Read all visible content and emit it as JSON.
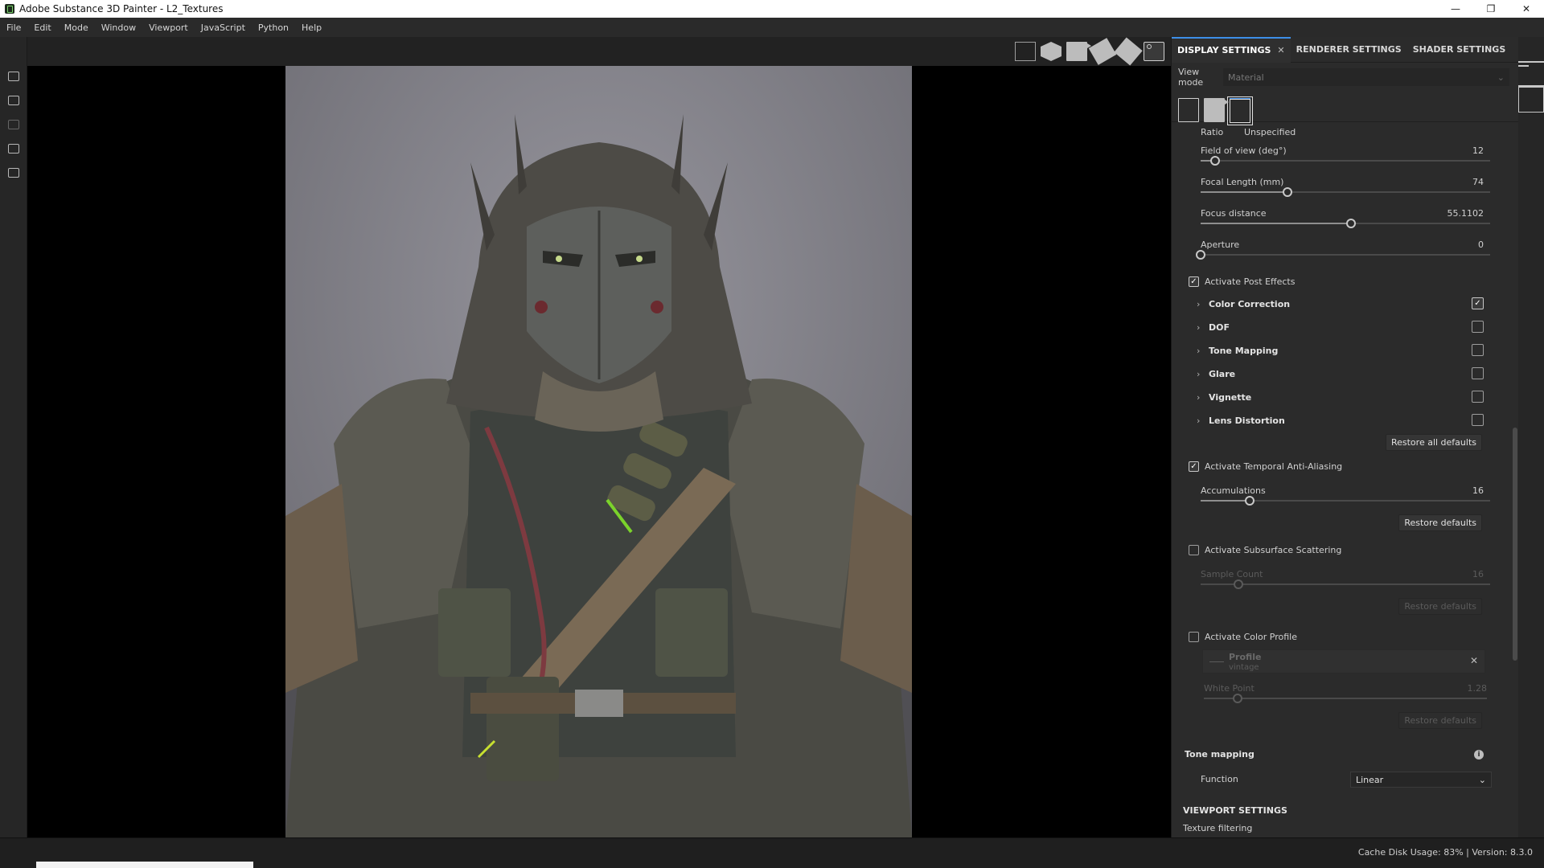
{
  "window": {
    "title": "Adobe Substance 3D Painter - L2_Textures",
    "controls": [
      "—",
      "❐",
      "✕"
    ]
  },
  "menu": [
    "File",
    "Edit",
    "Mode",
    "Window",
    "Viewport",
    "JavaScript",
    "Python",
    "Help"
  ],
  "panel": {
    "tabs": [
      {
        "label": "DISPLAY SETTINGS",
        "close": "✕"
      },
      {
        "label": "RENDERER SETTINGS"
      },
      {
        "label": "SHADER SETTINGS"
      }
    ],
    "view_mode": {
      "label": "View mode",
      "value": "Material"
    },
    "ratio": {
      "label": "Ratio",
      "value": "Unspecified"
    },
    "sliders": [
      {
        "label": "Field of view (deg°)",
        "value": "12",
        "fraction": 0.05
      },
      {
        "label": "Focal Length (mm)",
        "value": "74",
        "fraction": 0.3
      },
      {
        "label": "Focus distance",
        "value": "55.1102",
        "fraction": 0.52
      },
      {
        "label": "Aperture",
        "value": "0",
        "fraction": 0.0
      }
    ],
    "post_effects": {
      "label": "Activate Post Effects",
      "checked": true,
      "sections": [
        {
          "name": "Color Correction",
          "checked": true
        },
        {
          "name": "DOF",
          "checked": false
        },
        {
          "name": "Tone Mapping",
          "checked": false
        },
        {
          "name": "Glare",
          "checked": false
        },
        {
          "name": "Vignette",
          "checked": false
        },
        {
          "name": "Lens Distortion",
          "checked": false
        }
      ],
      "restore_all": "Restore all defaults"
    },
    "taa": {
      "label": "Activate Temporal Anti-Aliasing",
      "checked": true,
      "accumulations": {
        "label": "Accumulations",
        "value": "16",
        "fraction": 0.17
      },
      "restore": "Restore defaults"
    },
    "sss": {
      "label": "Activate Subsurface Scattering",
      "checked": false,
      "sample_count": {
        "label": "Sample Count",
        "value": "16",
        "fraction": 0.13
      },
      "restore": "Restore defaults"
    },
    "color_profile": {
      "label": "Activate Color Profile",
      "checked": false,
      "profile_title": "Profile",
      "profile_value": "vintage",
      "white_point": {
        "label": "White Point",
        "value": "1.28",
        "fraction": 0.12
      },
      "restore": "Restore defaults"
    },
    "tone_mapping": {
      "heading": "Tone mapping",
      "function_label": "Function",
      "function_value": "Linear"
    },
    "viewport_settings": {
      "heading": "VIEWPORT SETTINGS",
      "texture_filtering": "Texture filtering"
    }
  },
  "status": {
    "cache": "Cache Disk Usage:  83% | Version: 8.3.0"
  },
  "colors": {
    "accent": "#3d8ee8",
    "panel_bg": "#2b2b2b",
    "viewport_bg": "#000000"
  }
}
